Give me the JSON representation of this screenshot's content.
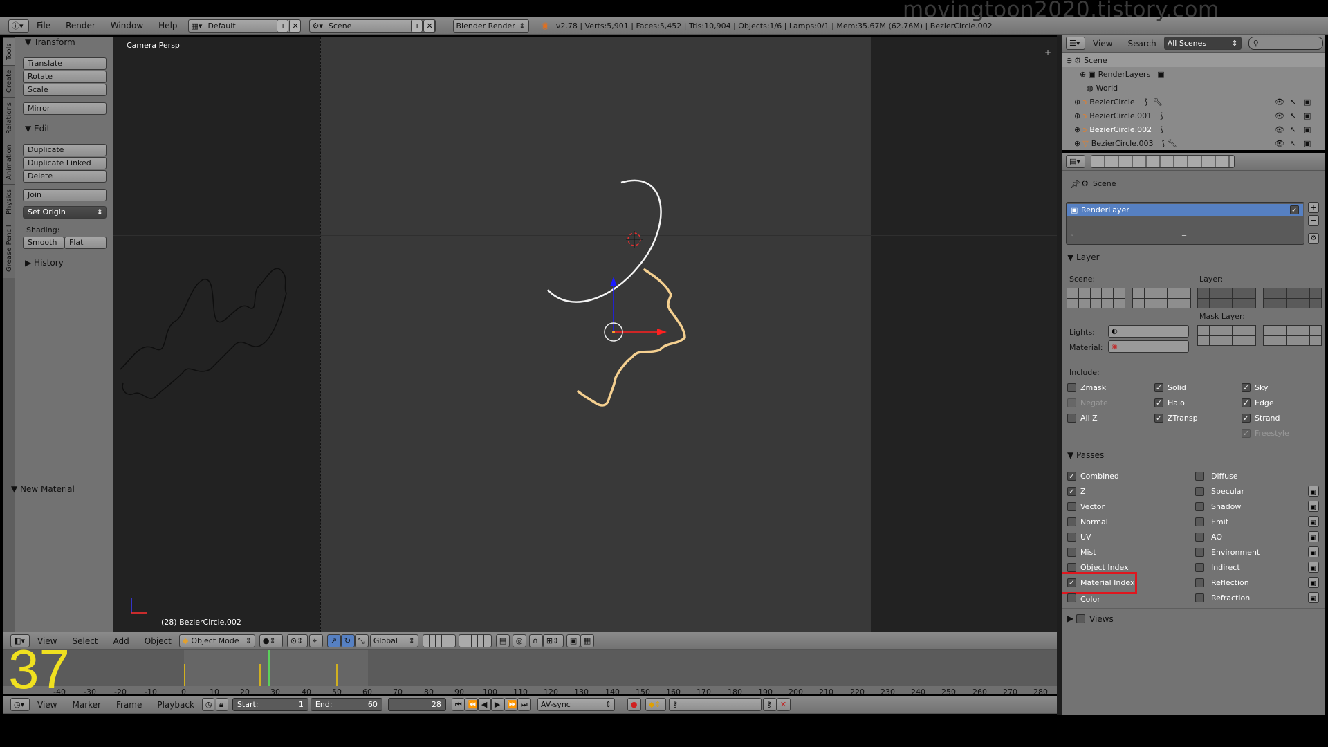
{
  "watermark": "movingtoon2020.tistory.com",
  "overlay_number": "37",
  "info_header": {
    "menus": [
      "File",
      "Render",
      "Window",
      "Help"
    ],
    "layout": "Default",
    "scene": "Scene",
    "engine": "Blender Render",
    "stats": "v2.78 | Verts:5,901 | Faces:5,452 | Tris:10,904 | Objects:1/6 | Lamps:0/1 | Mem:35.67M (62.76M) | BezierCircle.002"
  },
  "tool_tabs": [
    "Tools",
    "Create",
    "Relations",
    "Animation",
    "Physics",
    "Grease Pencil"
  ],
  "tool_shelf": {
    "transform_header": "Transform",
    "translate": "Translate",
    "rotate": "Rotate",
    "scale": "Scale",
    "mirror": "Mirror",
    "edit_header": "Edit",
    "duplicate": "Duplicate",
    "duplicate_linked": "Duplicate Linked",
    "delete": "Delete",
    "join": "Join",
    "set_origin": "Set Origin",
    "shading_label": "Shading:",
    "smooth": "Smooth",
    "flat": "Flat",
    "history_header": "History",
    "new_material": "New Material"
  },
  "viewport": {
    "view_label": "Camera Persp",
    "object_label": "(28) BezierCircle.002"
  },
  "view3d_header": {
    "menus": [
      "View",
      "Select",
      "Add",
      "Object"
    ],
    "mode": "Object Mode",
    "orientation": "Global"
  },
  "timeline": {
    "ticks": [
      "-40",
      "-30",
      "-20",
      "-10",
      "0",
      "10",
      "20",
      "30",
      "40",
      "50",
      "60",
      "70",
      "80",
      "90",
      "100",
      "110",
      "120",
      "130",
      "140",
      "150",
      "160",
      "170",
      "180",
      "190",
      "200",
      "210",
      "220",
      "230",
      "240",
      "250",
      "260",
      "270",
      "280"
    ],
    "menus": [
      "View",
      "Marker",
      "Frame",
      "Playback"
    ],
    "start_label": "Start:",
    "start_value": "1",
    "end_label": "End:",
    "end_value": "60",
    "current_frame": "28",
    "sync": "AV-sync"
  },
  "outliner": {
    "menus": [
      "View",
      "Search"
    ],
    "filter": "All Scenes",
    "rows": [
      "Scene",
      "RenderLayers",
      "World",
      "BezierCircle",
      "BezierCircle.001",
      "BezierCircle.002",
      "BezierCircle.003"
    ]
  },
  "properties": {
    "breadcrumb": "Scene",
    "render_layer": "RenderLayer",
    "layer_panel": "Layer",
    "scene_label": "Scene:",
    "layer_label": "Layer:",
    "mask_layer_label": "Mask Layer:",
    "lights_label": "Lights:",
    "material_label": "Material:",
    "include_label": "Include:",
    "include": [
      {
        "label": "Zmask",
        "checked": false
      },
      {
        "label": "Negate",
        "checked": false
      },
      {
        "label": "All Z",
        "checked": false
      },
      {
        "label": "Solid",
        "checked": true
      },
      {
        "label": "Halo",
        "checked": true
      },
      {
        "label": "ZTransp",
        "checked": true
      },
      {
        "label": "Sky",
        "checked": true
      },
      {
        "label": "Edge",
        "checked": true
      },
      {
        "label": "Strand",
        "checked": true
      },
      {
        "label": "Freestyle",
        "checked": true
      }
    ],
    "passes_panel": "Passes",
    "passes_left": [
      {
        "label": "Combined",
        "checked": true
      },
      {
        "label": "Z",
        "checked": true
      },
      {
        "label": "Vector",
        "checked": false
      },
      {
        "label": "Normal",
        "checked": false
      },
      {
        "label": "UV",
        "checked": false
      },
      {
        "label": "Mist",
        "checked": false
      },
      {
        "label": "Object Index",
        "checked": false
      },
      {
        "label": "Material Index",
        "checked": true
      },
      {
        "label": "Color",
        "checked": false
      }
    ],
    "passes_right": [
      {
        "label": "Diffuse",
        "checked": false
      },
      {
        "label": "Specular",
        "checked": false
      },
      {
        "label": "Shadow",
        "checked": false
      },
      {
        "label": "Emit",
        "checked": false
      },
      {
        "label": "AO",
        "checked": false
      },
      {
        "label": "Environment",
        "checked": false
      },
      {
        "label": "Indirect",
        "checked": false
      },
      {
        "label": "Reflection",
        "checked": false
      },
      {
        "label": "Refraction",
        "checked": false
      }
    ],
    "views_panel": "Views"
  },
  "colors": {
    "highlight": "#e0161e",
    "selection": "#5680c2",
    "curve_selected": "#f5d090",
    "overlay_number": "#f0e020"
  }
}
